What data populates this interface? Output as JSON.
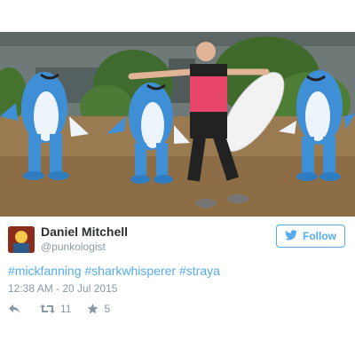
{
  "tweet": {
    "author_name": "Daniel Mitchell",
    "author_handle": "@punkologist",
    "follow_label": "Follow",
    "hashtags": "#mickfanning #sharkwhisperer #straya",
    "timestamp": "12:38 AM - 20 Jul 2015",
    "retweet_count": "11",
    "favorite_count": "5"
  },
  "icons": {
    "bird": "twitter-bird-icon",
    "reply": "reply-icon",
    "retweet": "retweet-icon",
    "favorite": "star-icon"
  },
  "colors": {
    "accent": "#55acee",
    "name_text": "#292f33",
    "muted_text": "#8899a6",
    "shark_blue": "#3f8fd6",
    "rash_vest_pink": "#e8456b"
  }
}
